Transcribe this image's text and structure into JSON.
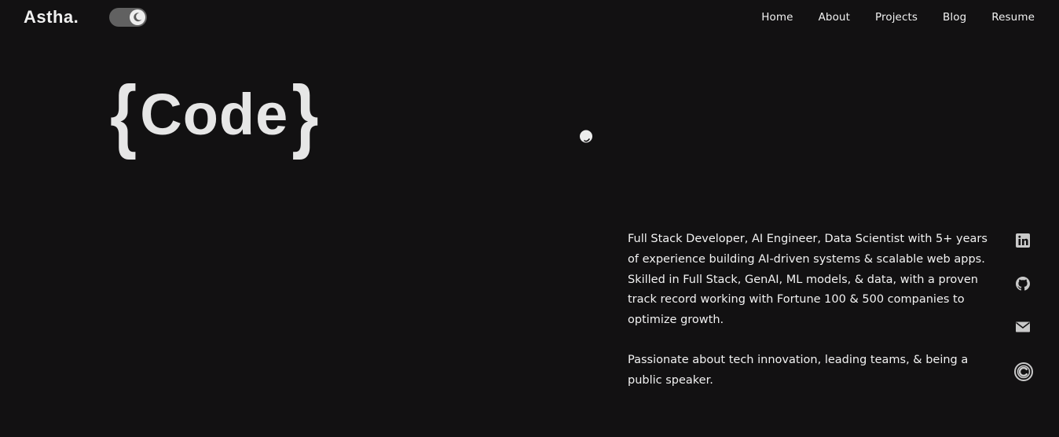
{
  "header": {
    "logo": "Astha.",
    "theme_toggle_icon": "moon-icon"
  },
  "nav": {
    "items": [
      {
        "label": "Home"
      },
      {
        "label": "About"
      },
      {
        "label": "Projects"
      },
      {
        "label": "Blog"
      },
      {
        "label": "Resume"
      }
    ]
  },
  "hero": {
    "open_brace": "{",
    "word": "Code",
    "close_brace": "}"
  },
  "about": {
    "paragraph_1": "Full Stack Developer, AI Engineer, Data Scientist with 5+ years of experience building AI-driven systems & scalable web apps. Skilled in Full Stack, GenAI, ML models, & data, with a proven track record working with Fortune 100 & 500 companies to optimize growth.",
    "paragraph_2": "Passionate about tech innovation, leading teams, & being a public speaker."
  },
  "socials": {
    "icons": [
      "linkedin-icon",
      "github-icon",
      "mail-icon",
      "copyright-icon"
    ]
  },
  "colors": {
    "background": "#121112",
    "text": "#f2f2f2",
    "toggle_track": "#616161",
    "icon": "#c9c9c9"
  }
}
